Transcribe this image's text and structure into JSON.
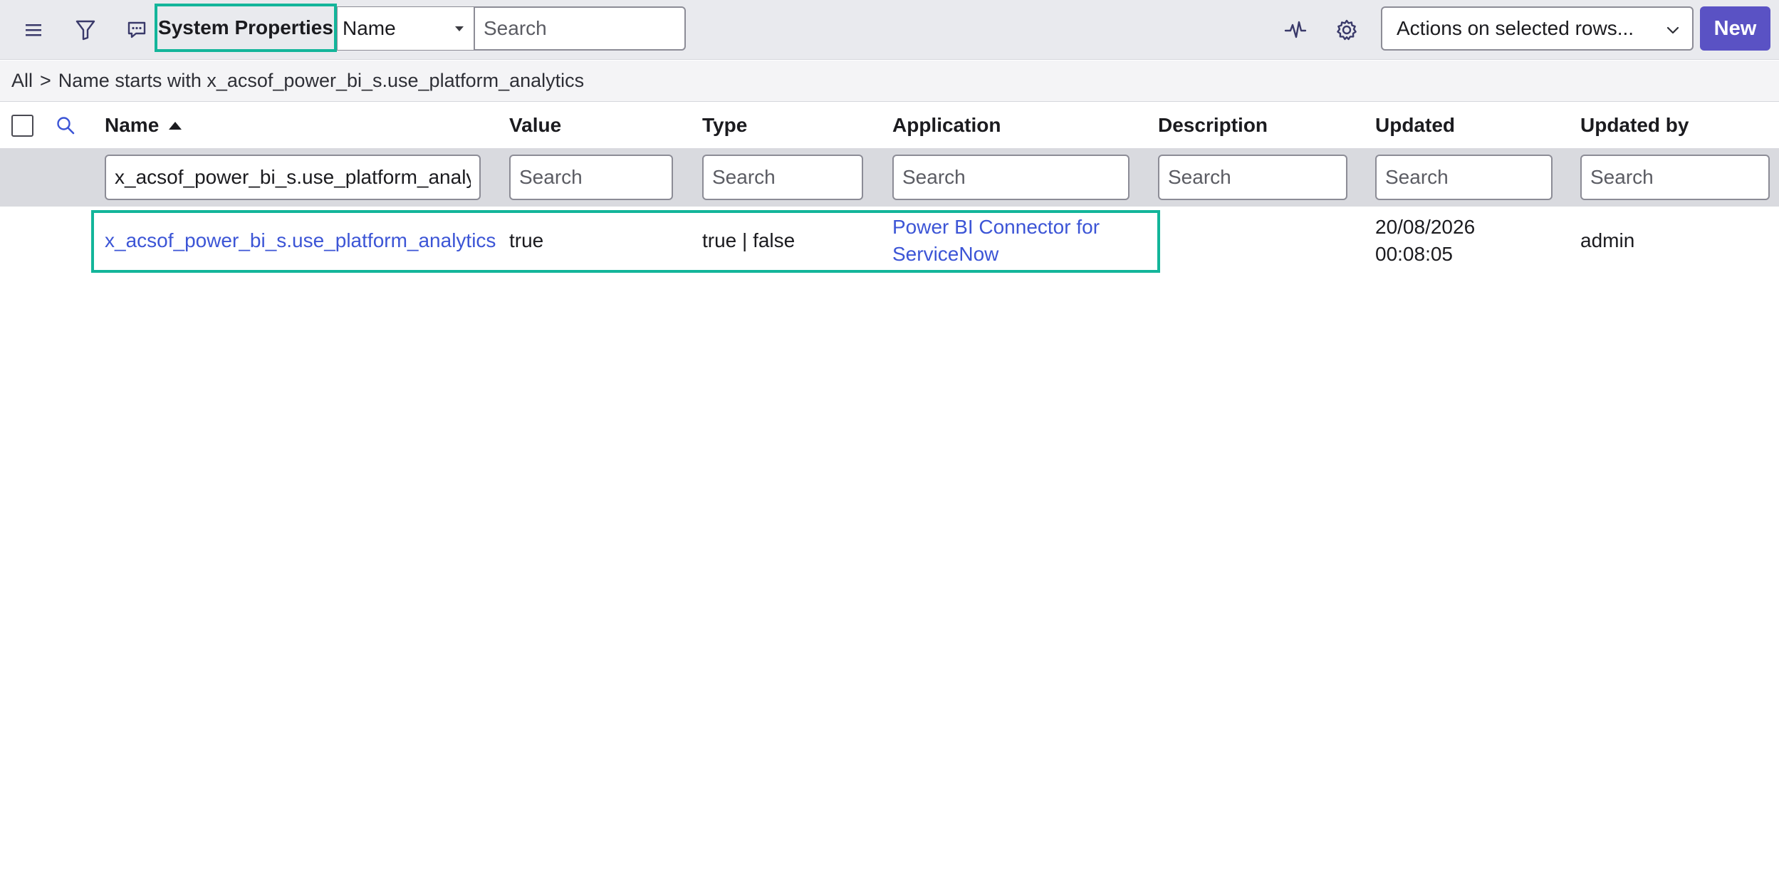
{
  "toolbar": {
    "title": "System Properties",
    "field_select_value": "Name",
    "search_placeholder": "Search",
    "actions_select_value": "Actions on selected rows...",
    "new_label": "New",
    "icons": [
      "hamburger-icon",
      "filter-icon",
      "comment-icon",
      "activity-icon",
      "gear-icon"
    ],
    "accent_color": "#5a52c4",
    "highlight_color": "#13b59a"
  },
  "breadcrumb": {
    "root": "All",
    "separator": ">",
    "condition": "Name starts with x_acsof_power_bi_s.use_platform_analytics"
  },
  "columns": {
    "name": "Name",
    "value": "Value",
    "type": "Type",
    "application": "Application",
    "description": "Description",
    "updated": "Updated",
    "updated_by": "Updated by"
  },
  "filters": {
    "name_value": "x_acsof_power_bi_s.use_platform_analytics",
    "placeholder": "Search"
  },
  "rows": [
    {
      "name": "x_acsof_power_bi_s.use_platform_analytics",
      "value": "true",
      "type": "true | false",
      "application_line1": "Power BI Connector for",
      "application_line2": "ServiceNow",
      "description": "",
      "updated_line1": "20/08/2026",
      "updated_line2": "00:08:05",
      "updated_by": "admin"
    }
  ]
}
